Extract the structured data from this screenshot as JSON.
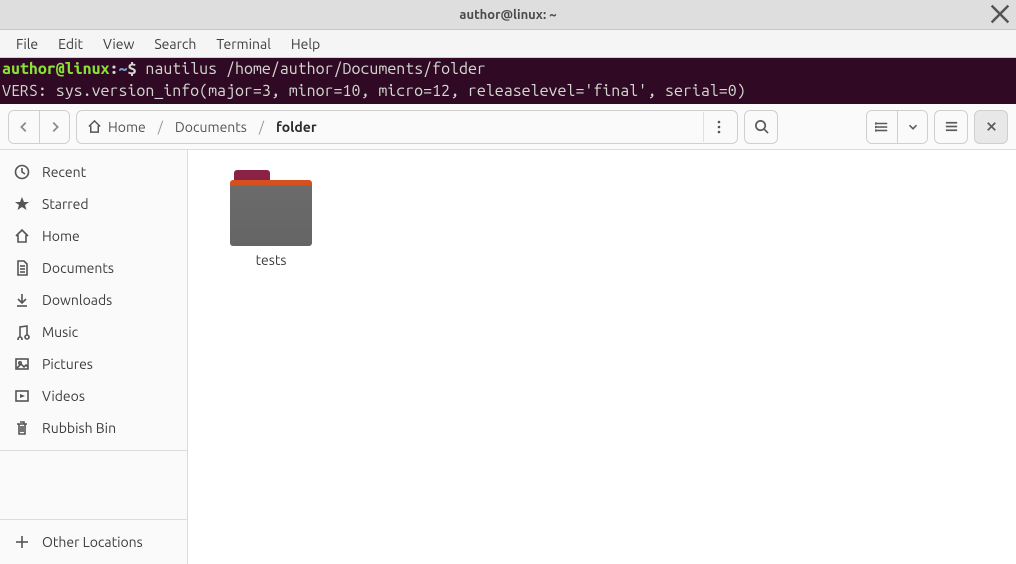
{
  "title_bar": {
    "title": "author@linux: ~"
  },
  "menubar": {
    "items": [
      "File",
      "Edit",
      "View",
      "Search",
      "Terminal",
      "Help"
    ]
  },
  "terminal": {
    "user": "author@linux",
    "colon": ":",
    "path": "~",
    "dollar": "$",
    "command": "nautilus /home/author/Documents/folder",
    "output": "VERS: sys.version_info(major=3, minor=10, micro=12, releaselevel='final', serial=0)"
  },
  "nautilus": {
    "breadcrumb": {
      "home": "Home",
      "p1": "Documents",
      "p2": "folder"
    },
    "sidebar": {
      "recent": "Recent",
      "starred": "Starred",
      "home": "Home",
      "documents": "Documents",
      "downloads": "Downloads",
      "music": "Music",
      "pictures": "Pictures",
      "videos": "Videos",
      "trash": "Rubbish Bin",
      "other": "Other Locations"
    },
    "files": [
      {
        "name": "tests"
      }
    ]
  }
}
